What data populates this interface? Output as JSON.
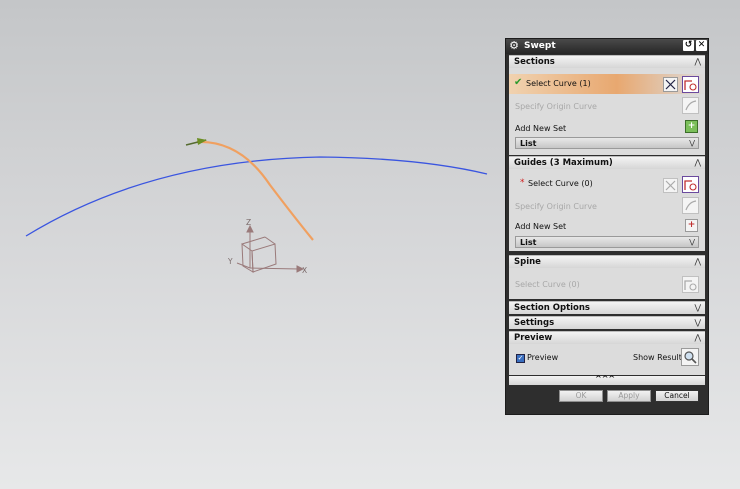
{
  "viewport": {
    "triad": {
      "z": "Z",
      "y": "Y",
      "x": "X"
    },
    "colors": {
      "blue_curve": "#3a55e0",
      "orange_curve": "#f0a060"
    }
  },
  "dialog": {
    "title": "Swept",
    "sections": {
      "header": "Sections",
      "select_curve": "Select Curve (1)",
      "specify_origin": "Specify Origin Curve",
      "add_new_set": "Add New Set",
      "list": "List"
    },
    "guides": {
      "header": "Guides (3 Maximum)",
      "required_mark": "*",
      "select_curve": "Select Curve (0)",
      "specify_origin": "Specify Origin Curve",
      "add_new_set": "Add New Set",
      "list": "List"
    },
    "spine": {
      "header": "Spine",
      "select_curve": "Select Curve (0)"
    },
    "section_options": {
      "header": "Section Options"
    },
    "settings": {
      "header": "Settings"
    },
    "preview": {
      "header": "Preview",
      "checkbox_label": "Preview",
      "show_result": "Show Result"
    },
    "buttons": {
      "ok": "OK",
      "apply": "Apply",
      "cancel": "Cancel"
    }
  }
}
